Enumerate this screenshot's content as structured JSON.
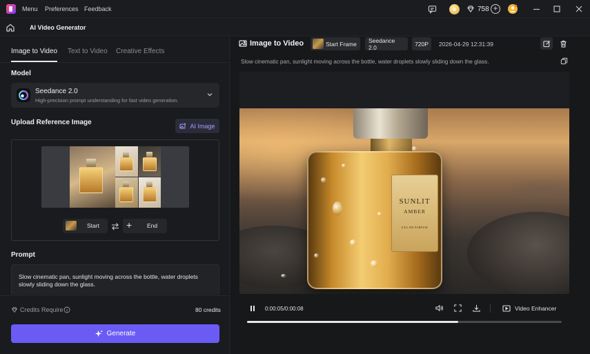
{
  "titlebar": {
    "menu": [
      "Menu",
      "Preferences",
      "Feedback"
    ],
    "credit_count": "758"
  },
  "nav": {
    "title": "AI Video Generator"
  },
  "left": {
    "tabs": [
      {
        "label": "Image to Video",
        "active": true
      },
      {
        "label": "Text to Video",
        "active": false
      },
      {
        "label": "Creative Effects",
        "active": false
      }
    ],
    "model_section": "Model",
    "model_name": "Seedance 2.0",
    "model_desc": "High-precision prompt understanding for fast video generation.",
    "upload_section": "Upload Reference Image",
    "ai_image_label": "AI Image",
    "start_label": "Start",
    "end_label": "End",
    "prompt_section": "Prompt",
    "prompt_text": "Slow cinematic pan, sunlight moving across the bottle, water droplets slowly sliding down the glass.",
    "credits_label": "Credits Require",
    "credits_value": "80 credits",
    "generate_label": "Generate"
  },
  "result": {
    "title": "Image to Video",
    "chip_start_frame": "Start Frame",
    "chip_model": "Seedance 2.0",
    "chip_resolution": "720P",
    "timestamp": "2026-04-29 12:31:39",
    "prompt": "Slow cinematic pan, sunlight moving across the bottle, water droplets slowly sliding down the glass.",
    "label_brand": "SUNLIT",
    "label_name": "AMBER",
    "label_type": "EAU DE PARFUM"
  },
  "player": {
    "time": "0:00:05/0:00:08",
    "progress_percent": 67,
    "enhancer_label": "Video Enhancer"
  },
  "colors": {
    "accent": "#6b5bf5",
    "ai_accent": "#a89bff"
  }
}
